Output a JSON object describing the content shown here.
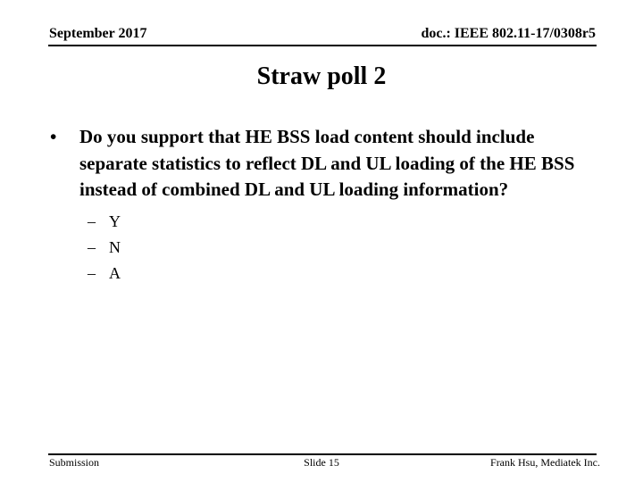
{
  "header": {
    "date": "September 2017",
    "doc_id": "doc.: IEEE 802.11-17/0308r5"
  },
  "slide": {
    "title": "Straw poll 2",
    "bullets": [
      {
        "glyph": "•",
        "text": "Do you support that HE BSS load content should include separate statistics to reflect DL and UL loading of the HE BSS instead of combined DL and UL loading information?",
        "sub_items": [
          {
            "glyph": "–",
            "text": "Y"
          },
          {
            "glyph": "–",
            "text": "N"
          },
          {
            "glyph": "–",
            "text": "A"
          }
        ]
      }
    ]
  },
  "footer": {
    "left": "Submission",
    "center": "Slide 15",
    "right": "Frank Hsu, Mediatek Inc."
  }
}
